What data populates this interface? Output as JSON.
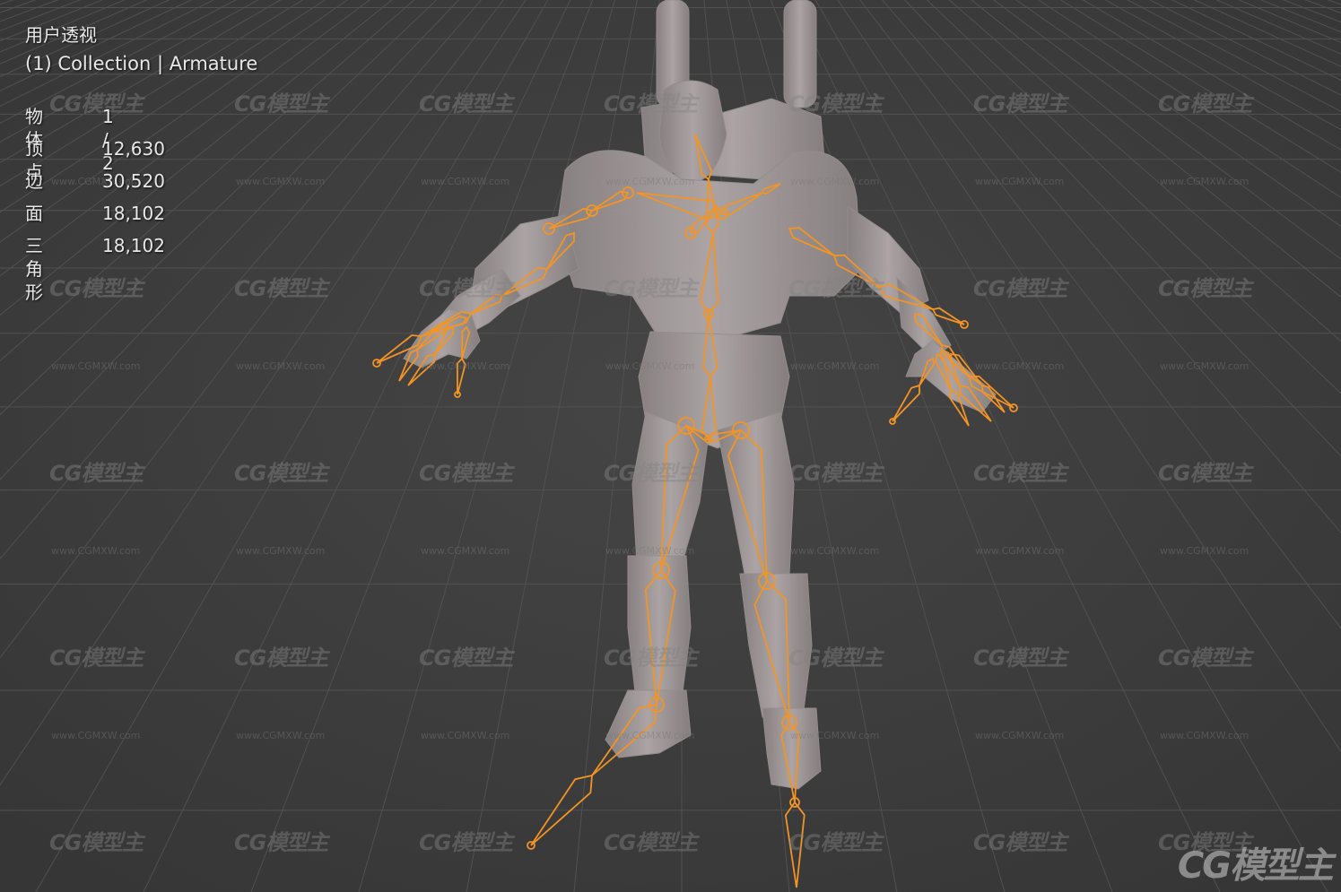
{
  "viewport": {
    "view_name": "用户透视",
    "collection_line": "(1) Collection | Armature"
  },
  "stats": [
    {
      "label": "物体",
      "value": "1 / 2"
    },
    {
      "label": "顶点",
      "value": "12,630"
    },
    {
      "label": "边",
      "value": "30,520"
    },
    {
      "label": "面",
      "value": "18,102"
    },
    {
      "label": "三角形",
      "value": "18,102"
    }
  ],
  "watermark": {
    "logo": "CG模型主",
    "url": "www.CGMXW.com"
  },
  "colors": {
    "background": "#3d3d3d",
    "grid": "#505050",
    "mesh": "#a39a9a",
    "bone": "#f39424"
  }
}
